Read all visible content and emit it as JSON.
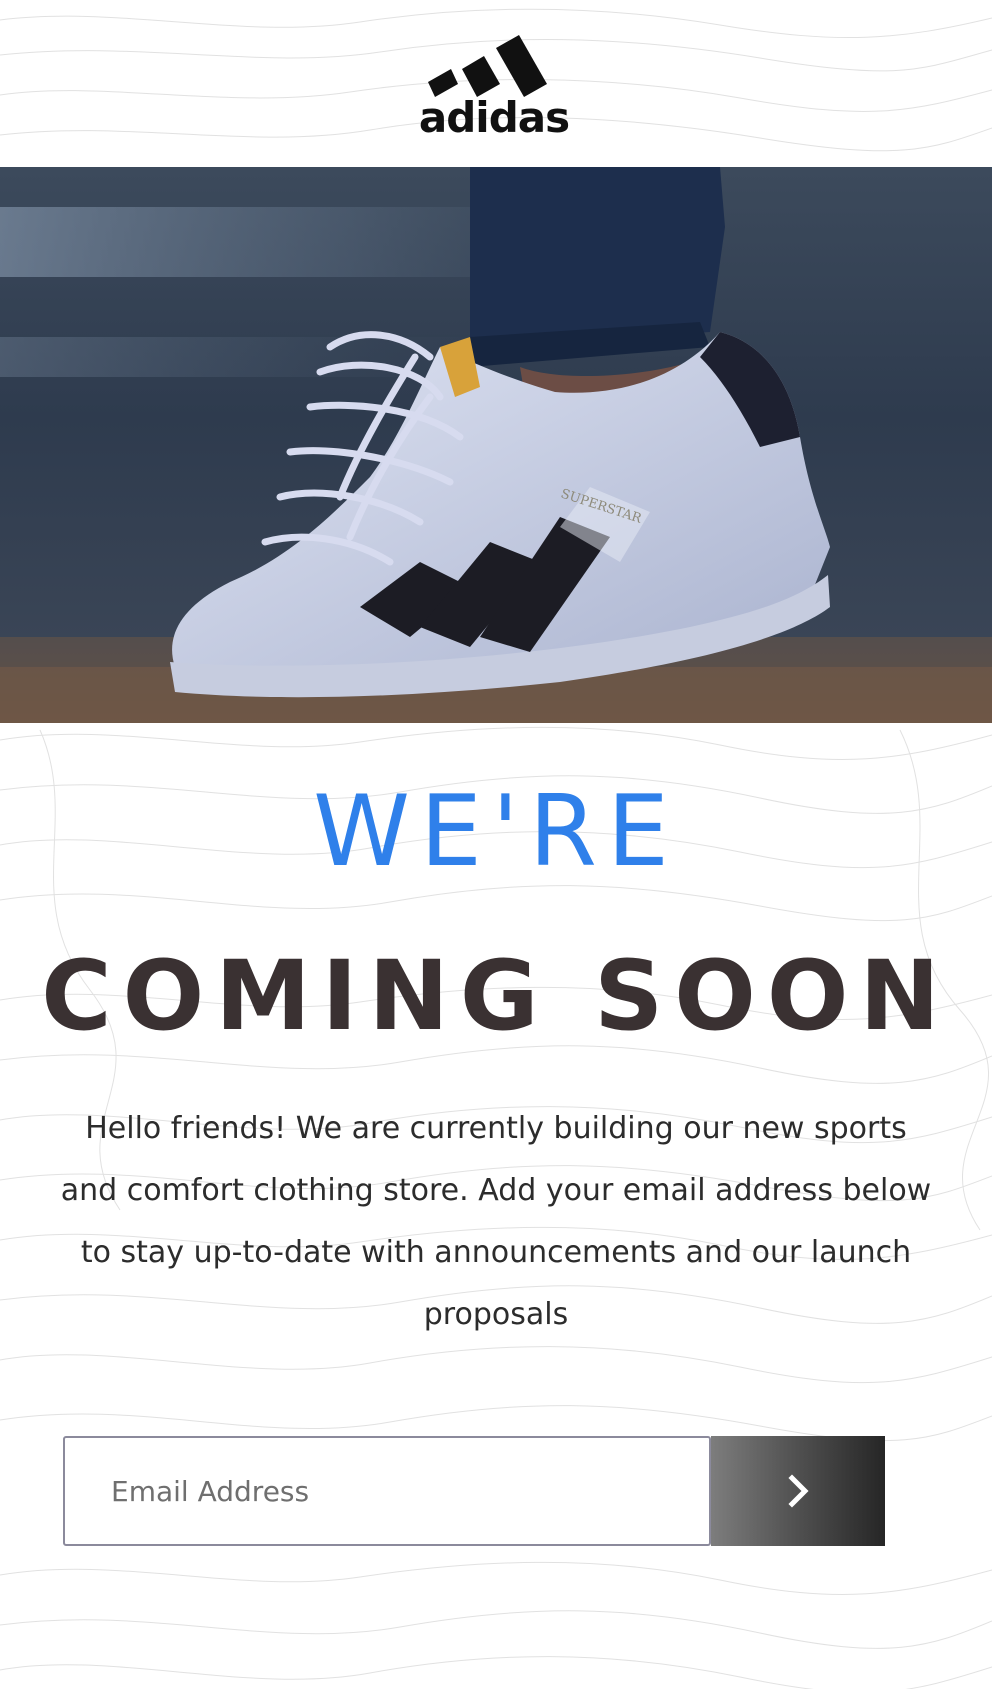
{
  "brand": {
    "name": "adidas",
    "icon": "adidas-logo-icon"
  },
  "hero": {
    "image": "sneaker-photo",
    "shoe_text": "SUPERSTAR"
  },
  "headline": {
    "line1": "WE'RE",
    "line2": "COMING SOON"
  },
  "intro": {
    "text": "Hello friends! We are currently building our new sports and comfort clothing store. Add your email address below to stay up-to-date with announcements and our launch proposals"
  },
  "subscribe": {
    "placeholder": "Email Address",
    "value": "",
    "submit_icon": "chevron-right-icon"
  },
  "colors": {
    "accent": "#2f80ea",
    "title": "#3a3132",
    "body_text": "#2c2c2c"
  }
}
